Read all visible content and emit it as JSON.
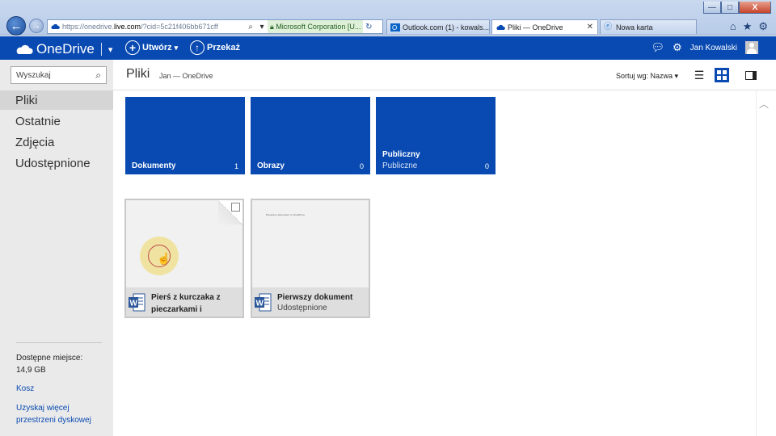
{
  "browser": {
    "address_url_prefix": "https://onedrive.",
    "address_url_host": "live.com",
    "address_url_rest": "/?cid=5c21f406bb671cff",
    "cert_label": "Microsoft Corporation [U...",
    "tabs": [
      {
        "label": "Outlook.com (1) - kowals..."
      },
      {
        "label": "Pliki — OneDrive"
      },
      {
        "label": "Nowa karta"
      }
    ],
    "win_minimize": "—",
    "win_maximize": "□",
    "win_close": "X"
  },
  "app": {
    "brand": "OneDrive",
    "create_label": "Utwórz",
    "upload_label": "Przekaż",
    "user_name": "Jan Kowalski"
  },
  "sidebar": {
    "search_placeholder": "Wyszukaj",
    "items": [
      {
        "label": "Pliki"
      },
      {
        "label": "Ostatnie"
      },
      {
        "label": "Zdjęcia"
      },
      {
        "label": "Udostępnione"
      }
    ],
    "storage_label": "Dostępne miejsce:",
    "storage_value": "14,9 GB",
    "trash": "Kosz",
    "get_more_line1": "Uzyskaj więcej",
    "get_more_line2": "przestrzeni dyskowej"
  },
  "main": {
    "title": "Pliki",
    "breadcrumb": "Jan — OneDrive",
    "sort_label": "Sortuj wg: Nazwa"
  },
  "folders": [
    {
      "name": "Dokumenty",
      "sub": "",
      "count": "1"
    },
    {
      "name": "Obrazy",
      "sub": "",
      "count": "0"
    },
    {
      "name": "Publiczny",
      "sub": "Publiczne",
      "count": "0"
    }
  ],
  "files": [
    {
      "name_line1": "Pierś z kurczaka z",
      "name_line2": "pieczarkami i",
      "sub": ""
    },
    {
      "name_line1": "Pierwszy dokument",
      "name_line2": "",
      "sub": "Udostępnione",
      "preview_text": "Pierwszy dokument w OneDrive"
    }
  ],
  "colors": {
    "accent": "#094ab2",
    "sidebar_bg": "#eaeaea"
  }
}
